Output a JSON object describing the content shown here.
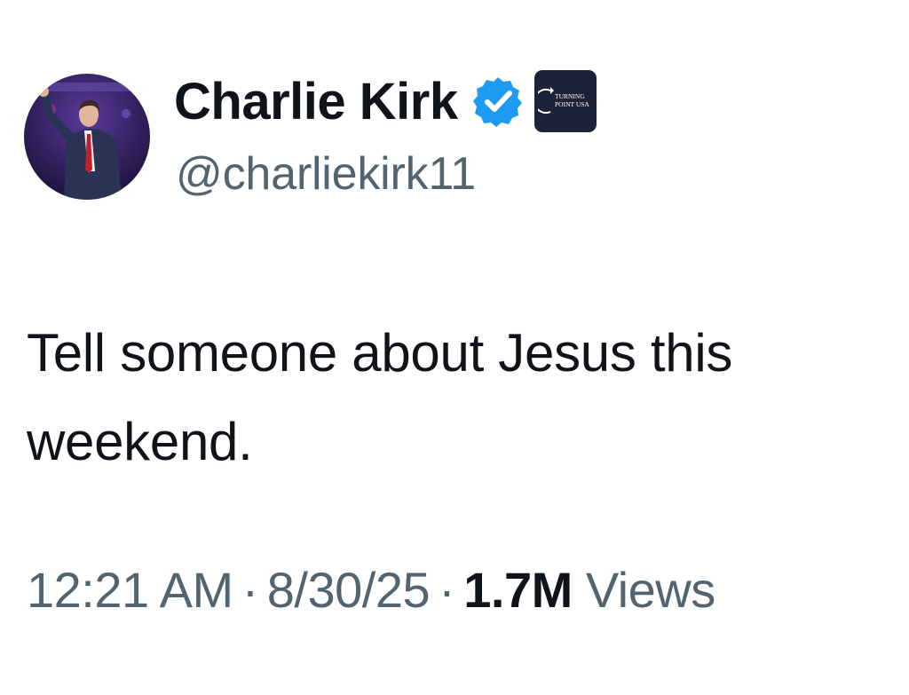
{
  "author": {
    "display_name": "Charlie Kirk",
    "handle": "@charliekirk11",
    "avatar_icon": "profile-photo",
    "verified_icon": "verified-badge-icon",
    "verified_color": "#1d9bf0",
    "affiliate_logo_text": "TURNING POINT USA",
    "affiliate_bg": "#1d2238"
  },
  "tweet": {
    "text": "Tell someone about Jesus this weekend."
  },
  "meta": {
    "time": "12:21 AM",
    "date": "8/30/25",
    "separator": "·",
    "views_count": "1.7M",
    "views_label": "Views"
  }
}
